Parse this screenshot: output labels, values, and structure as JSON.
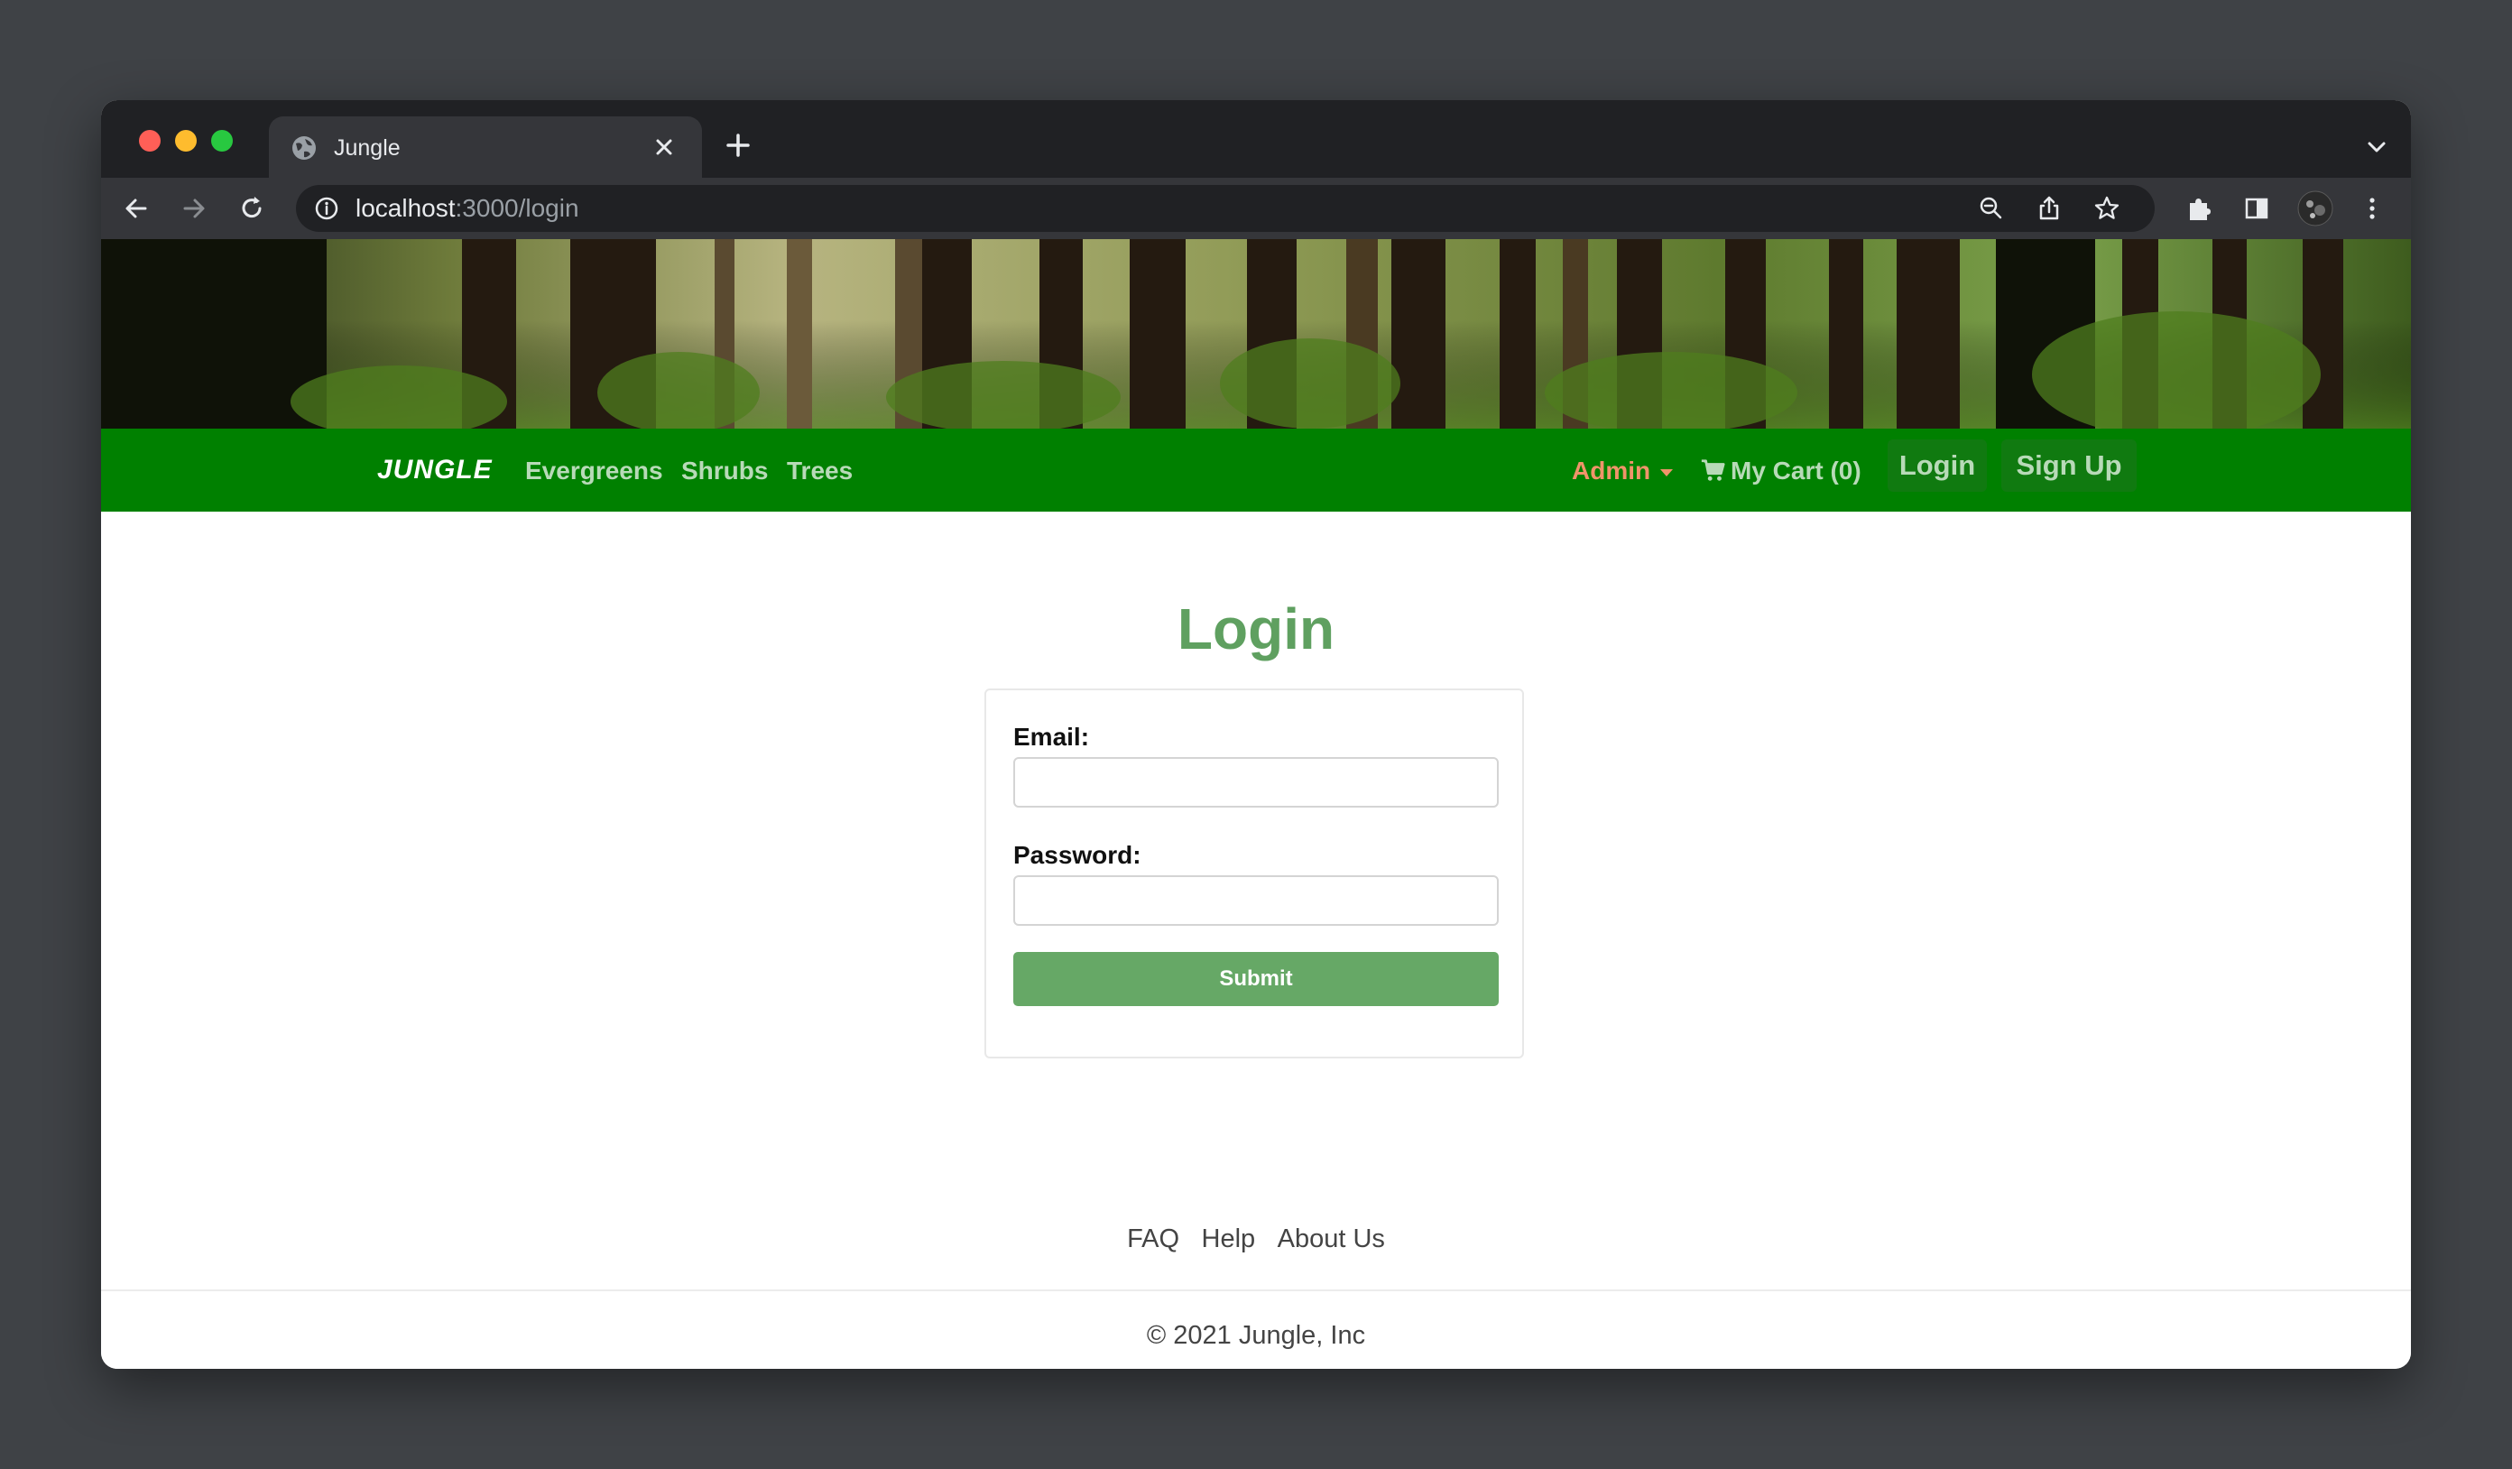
{
  "browser": {
    "tab_title": "Jungle",
    "url_host": "localhost",
    "url_rest": ":3000/login"
  },
  "nav": {
    "brand": "JUNGLE",
    "links": [
      "Evergreens",
      "Shrubs",
      "Trees"
    ],
    "admin": "Admin",
    "cart": "My Cart (0)",
    "login": "Login",
    "signup": "Sign Up"
  },
  "page": {
    "title": "Login",
    "email_label": "Email:",
    "email_value": "",
    "password_label": "Password:",
    "password_value": "",
    "submit": "Submit"
  },
  "footer": {
    "links": [
      "FAQ",
      "Help",
      "About Us"
    ],
    "copyright": "© 2021 Jungle, Inc"
  },
  "colors": {
    "navbar": "#008000",
    "accent": "#5fa060",
    "admin": "#f0946a"
  }
}
